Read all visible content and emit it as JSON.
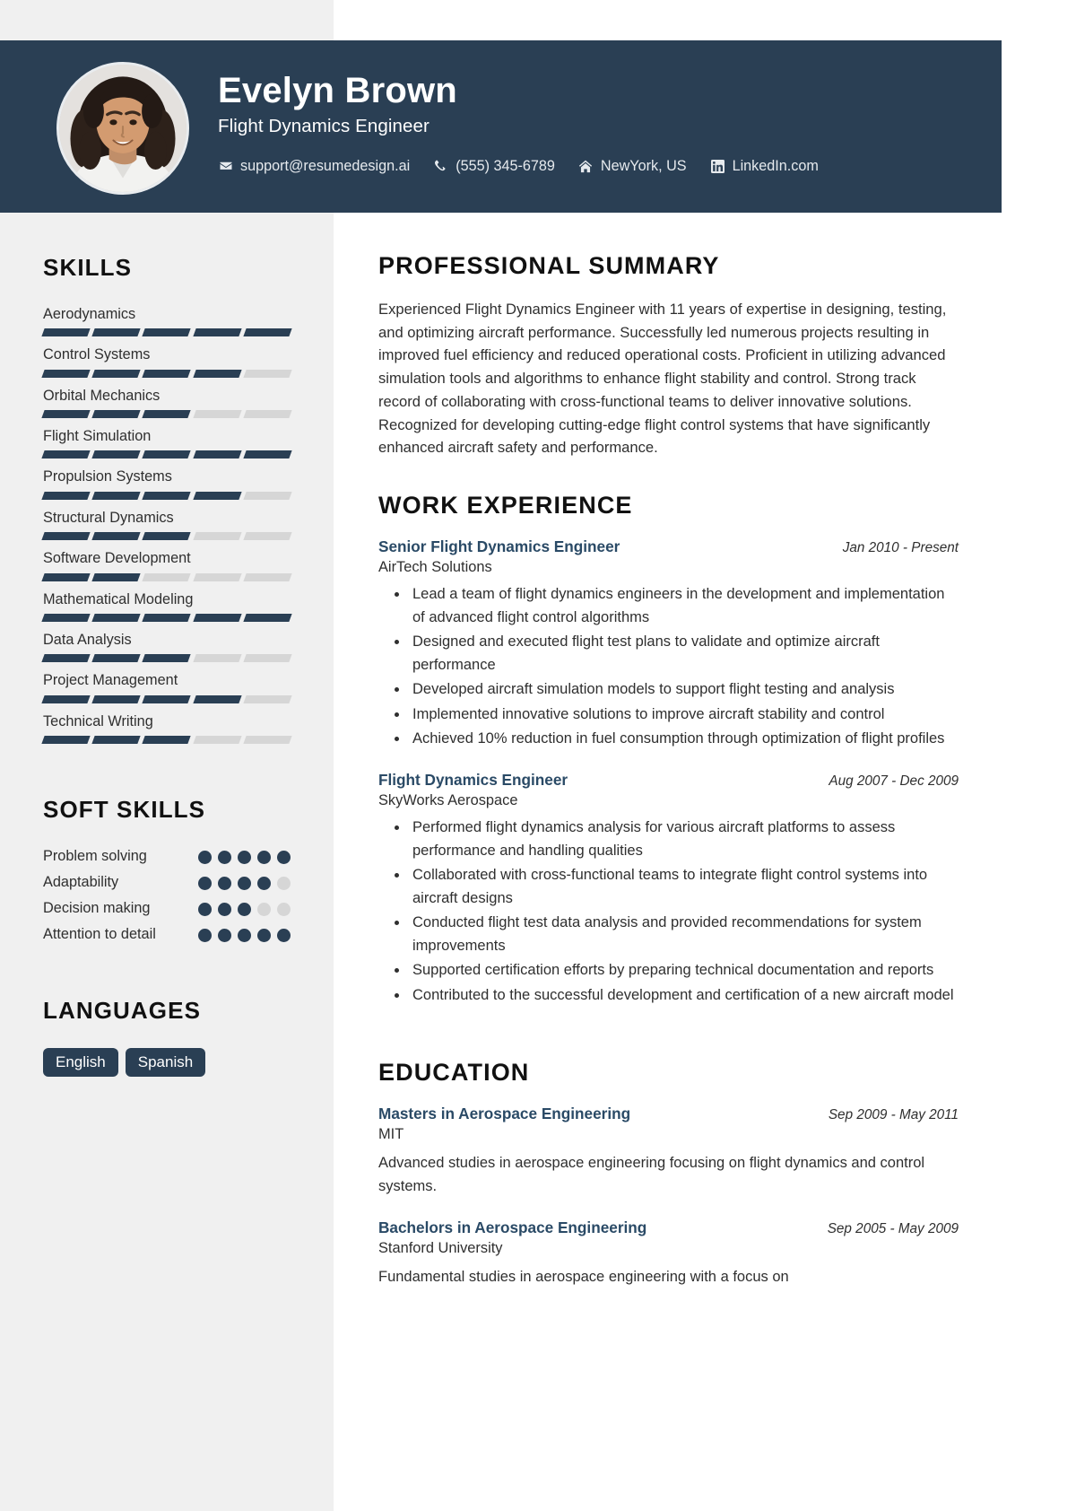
{
  "theme": {
    "navy": "#2a3f54",
    "sidebar_bg": "#f0f0f0",
    "title_link": "#2a4a66",
    "bar_off": "#d6d6d6"
  },
  "header": {
    "name": "Evelyn Brown",
    "role": "Flight Dynamics Engineer",
    "contacts": [
      {
        "icon": "envelope-icon",
        "text": "support@resumedesign.ai"
      },
      {
        "icon": "phone-icon",
        "text": "(555) 345-6789"
      },
      {
        "icon": "home-icon",
        "text": "NewYork, US"
      },
      {
        "icon": "linkedin-icon",
        "text": "LinkedIn.com"
      }
    ]
  },
  "sidebar": {
    "skills_heading": "SKILLS",
    "skills": [
      {
        "name": "Aerodynamics",
        "level": 5
      },
      {
        "name": "Control Systems",
        "level": 4
      },
      {
        "name": "Orbital Mechanics",
        "level": 3
      },
      {
        "name": "Flight Simulation",
        "level": 5
      },
      {
        "name": "Propulsion Systems",
        "level": 4
      },
      {
        "name": "Structural Dynamics",
        "level": 3
      },
      {
        "name": "Software Development",
        "level": 2
      },
      {
        "name": "Mathematical Modeling",
        "level": 5
      },
      {
        "name": "Data Analysis",
        "level": 3
      },
      {
        "name": "Project Management",
        "level": 4
      },
      {
        "name": "Technical Writing",
        "level": 3
      }
    ],
    "soft_skills_heading": "SOFT SKILLS",
    "soft_skills": [
      {
        "name": "Problem solving",
        "level": 5
      },
      {
        "name": "Adaptability",
        "level": 4
      },
      {
        "name": "Decision making",
        "level": 3
      },
      {
        "name": "Attention to detail",
        "level": 5
      }
    ],
    "languages_heading": "LANGUAGES",
    "languages": [
      "English",
      "Spanish"
    ]
  },
  "main": {
    "summary_heading": "PROFESSIONAL SUMMARY",
    "summary_text": "Experienced Flight Dynamics Engineer with 11 years of expertise in designing, testing, and optimizing aircraft performance. Successfully led numerous projects resulting in improved fuel efficiency and reduced operational costs. Proficient in utilizing advanced simulation tools and algorithms to enhance flight stability and control. Strong track record of collaborating with cross-functional teams to deliver innovative solutions. Recognized for developing cutting-edge flight control systems that have significantly enhanced aircraft safety and performance.",
    "experience_heading": "WORK EXPERIENCE",
    "experience": [
      {
        "title": "Senior Flight Dynamics Engineer",
        "date": "Jan 2010 - Present",
        "company": "AirTech Solutions",
        "bullets": [
          "Lead a team of flight dynamics engineers in the development and implementation of advanced flight control algorithms",
          "Designed and executed flight test plans to validate and optimize aircraft performance",
          "Developed aircraft simulation models to support flight testing and analysis",
          "Implemented innovative solutions to improve aircraft stability and control",
          "Achieved 10% reduction in fuel consumption through optimization of flight profiles"
        ]
      },
      {
        "title": "Flight Dynamics Engineer",
        "date": "Aug 2007 - Dec 2009",
        "company": "SkyWorks Aerospace",
        "bullets": [
          "Performed flight dynamics analysis for various aircraft platforms to assess performance and handling qualities",
          "Collaborated with cross-functional teams to integrate flight control systems into aircraft designs",
          "Conducted flight test data analysis and provided recommendations for system improvements",
          "Supported certification efforts by preparing technical documentation and reports",
          "Contributed to the successful development and certification of a new aircraft model"
        ]
      }
    ],
    "education_heading": "EDUCATION",
    "education": [
      {
        "degree": "Masters in Aerospace Engineering",
        "date": "Sep 2009 - May 2011",
        "school": "MIT",
        "description": "Advanced studies in aerospace engineering focusing on flight dynamics and control systems."
      },
      {
        "degree": "Bachelors in Aerospace Engineering",
        "date": "Sep 2005 - May 2009",
        "school": "Stanford University",
        "description": "Fundamental studies in aerospace engineering with a focus on"
      }
    ]
  }
}
